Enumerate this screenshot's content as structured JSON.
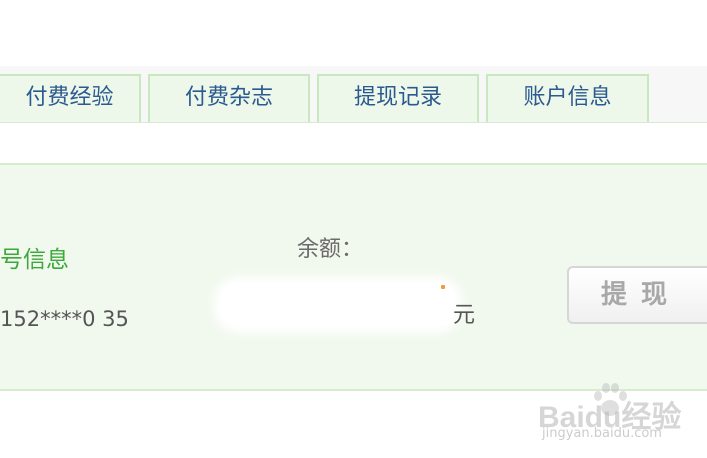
{
  "tabs": [
    {
      "label": "付费经验"
    },
    {
      "label": "付费杂志"
    },
    {
      "label": "提现记录"
    },
    {
      "label": "账户信息"
    }
  ],
  "account": {
    "title": "号信息",
    "phone": "152****0 35"
  },
  "balance": {
    "label": "余额：",
    "currency": "元"
  },
  "withdraw": {
    "label": "提现"
  },
  "watermark": {
    "logo": "Baidu经验",
    "url": "jingyan.baidu.com"
  },
  "colors": {
    "tab_text": "#2a5a8f",
    "tab_bg": "#eef8ea",
    "panel_bg": "#f1f9ee",
    "accent_green": "#3da83b",
    "button_text": "#a8a8a8"
  }
}
